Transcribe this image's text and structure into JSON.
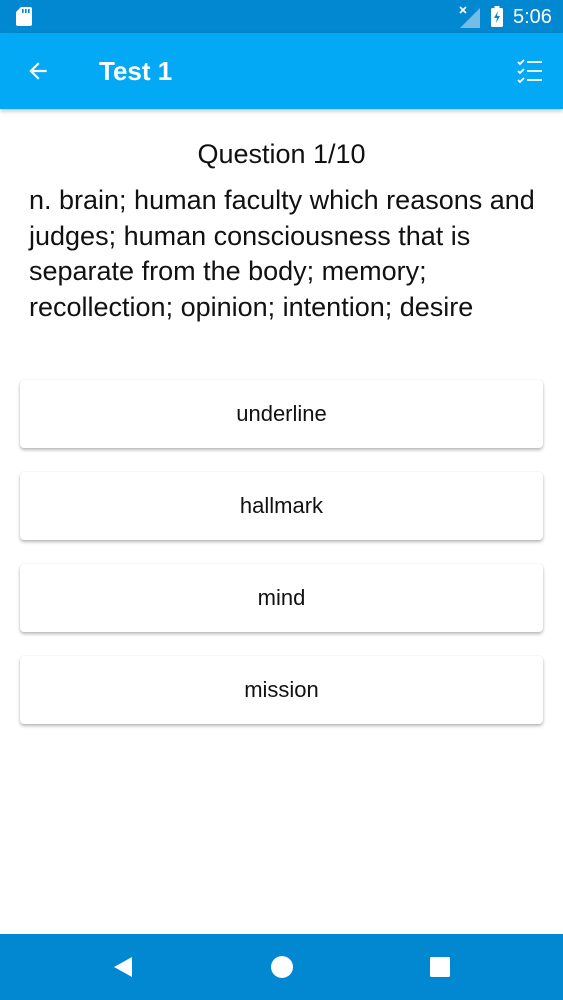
{
  "status_bar": {
    "time": "5:06",
    "icons": [
      "sd-card-icon",
      "signal-no-data-icon",
      "battery-charging-icon"
    ]
  },
  "app_bar": {
    "title": "Test 1",
    "icons": [
      "back-arrow-icon",
      "checklist-icon"
    ]
  },
  "question": {
    "header": "Question 1/10",
    "text": "n. brain; human faculty which reasons and judges; human consciousness that is separate from the body; memory; recollection; opinion; intention; desire"
  },
  "answers": [
    "underline",
    "hallmark",
    "mind",
    "mission"
  ],
  "nav_bar": {
    "icons": [
      "nav-back-icon",
      "nav-home-icon",
      "nav-recents-icon"
    ]
  },
  "colors": {
    "status_bar": "#0288d1",
    "app_bar": "#03a9f4",
    "nav_bar": "#0288d1",
    "background": "#ffffff"
  }
}
